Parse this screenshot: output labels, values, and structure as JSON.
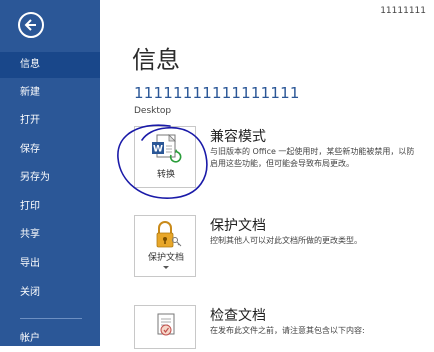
{
  "sidebar": {
    "items": [
      {
        "label": "信息"
      },
      {
        "label": "新建"
      },
      {
        "label": "打开"
      },
      {
        "label": "保存"
      },
      {
        "label": "另存为"
      },
      {
        "label": "打印"
      },
      {
        "label": "共享"
      },
      {
        "label": "导出"
      },
      {
        "label": "关闭"
      },
      {
        "label": "帐户"
      }
    ]
  },
  "header": {
    "user": "11111111"
  },
  "main": {
    "page_title": "信息",
    "doc_title": "11111111111111111",
    "doc_path": "Desktop",
    "sections": [
      {
        "title": "兼容模式",
        "description_line1": "与旧版本的 Office 一起使用时，某些新功能被禁用，以防",
        "description_line2": "启用这些功能，但可能会导致布局更改。",
        "button_label": "转换",
        "button_icon": "word-convert-icon"
      },
      {
        "title": "保护文档",
        "description_line1": "控制其他人可以对此文档所做的更改类型。",
        "button_label": "保护文档",
        "button_icon": "lock-key-icon"
      },
      {
        "title": "检查文档",
        "description_line1": "在发布此文件之前，请注意其包含以下内容:",
        "button_icon": "inspect-document-icon"
      }
    ]
  },
  "colors": {
    "sidebar_bg": "#2b5797",
    "sidebar_active": "#19478a",
    "accent": "#2b5797",
    "annotation_ink": "#1a1aa8"
  }
}
